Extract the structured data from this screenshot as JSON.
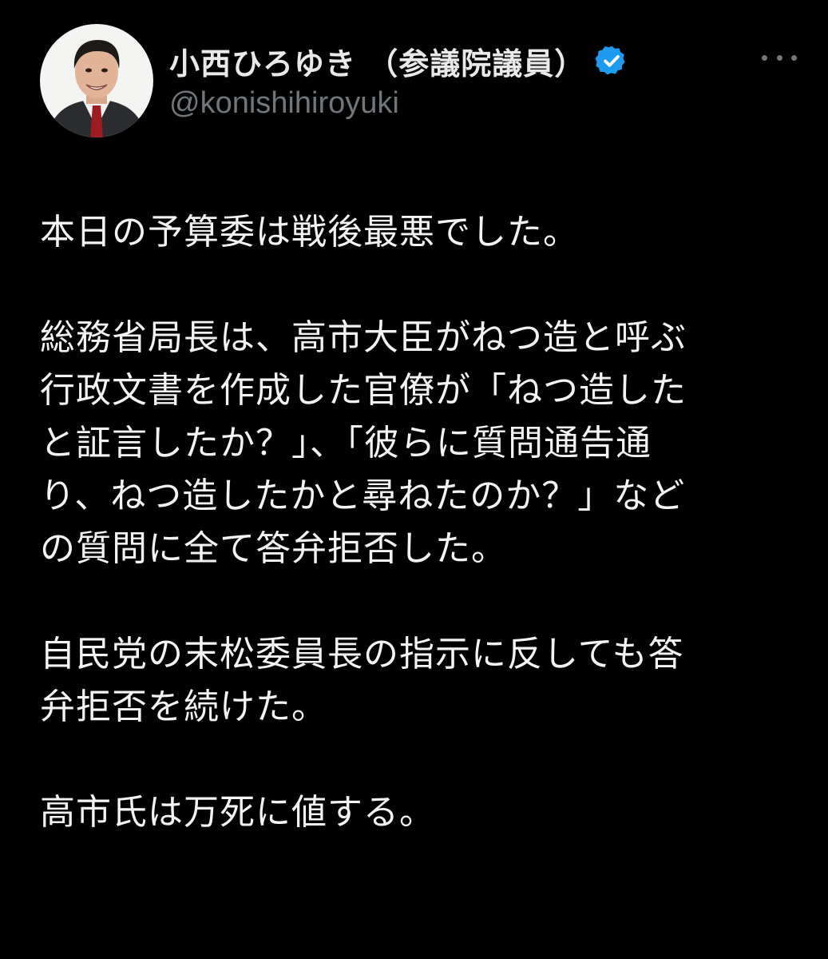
{
  "author": {
    "display_name": "小西ひろゆき （参議院議員）",
    "handle": "@konishihiroyuki",
    "verified": true,
    "verified_icon": "verified-badge-icon",
    "avatar_icon": "profile-photo"
  },
  "colors": {
    "background": "#000000",
    "text": "#e7e9ea",
    "secondary": "#71767b",
    "verified": "#1d9bf0"
  },
  "more_icon": "more-options-icon",
  "tweet": {
    "paragraphs": [
      {
        "lines": [
          "本日の予算委は戦後最悪でした。"
        ]
      },
      {
        "lines": [
          "総務省局長は、高市大臣がねつ造と呼ぶ",
          "行政文書を作成した官僚が「ねつ造した",
          "と証言したか？」、「彼らに質問通告通",
          "り、ねつ造したかと尋ねたのか？」など",
          "の質問に全て答弁拒否した。"
        ]
      },
      {
        "lines": [
          "自民党の末松委員長の指示に反しても答",
          "弁拒否を続けた。"
        ]
      },
      {
        "lines": [
          "高市氏は万死に値する。"
        ]
      }
    ]
  }
}
